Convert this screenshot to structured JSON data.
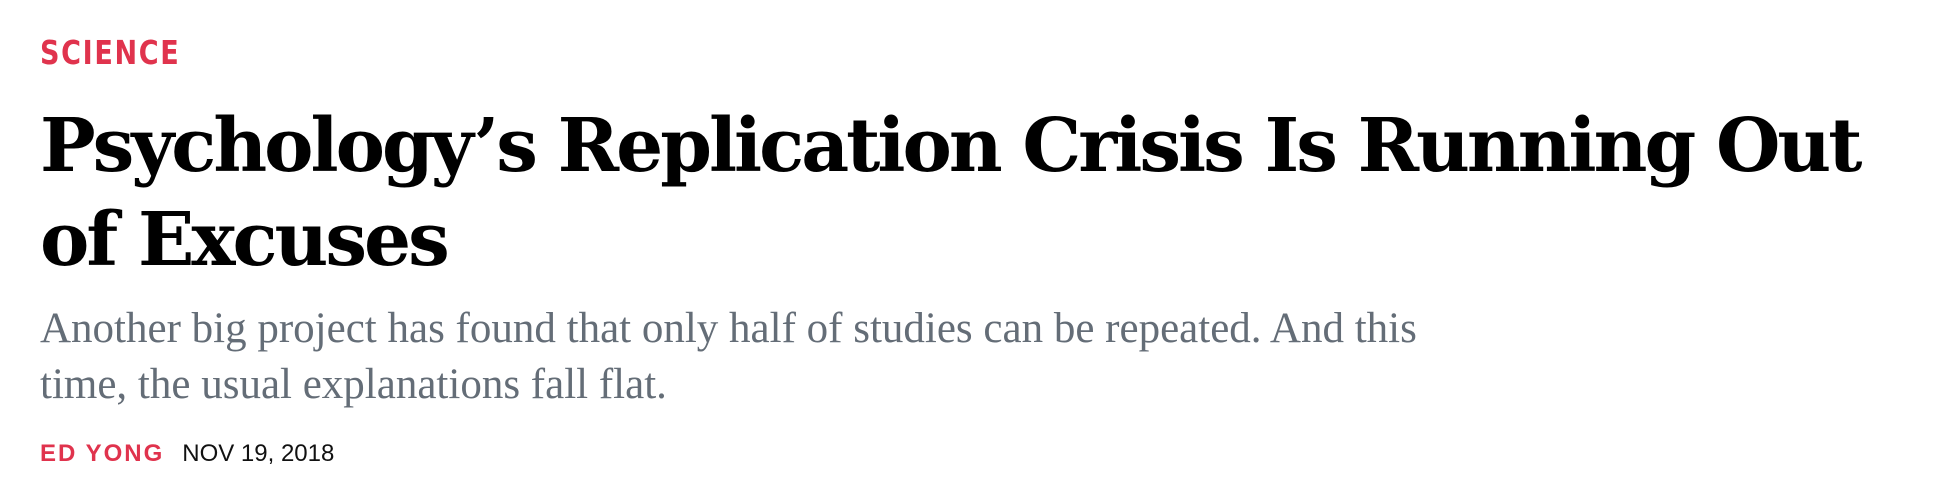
{
  "article": {
    "section": "SCIENCE",
    "headline": "Psychology’s Replication Crisis Is Running Out of Excuses",
    "dek": "Another big project has found that only half of studies can be repeated. And this time, the usual explanations fall flat.",
    "author": "ED YONG",
    "date": "NOV 19, 2018"
  },
  "colors": {
    "accent": "#e0334d",
    "headline": "#000000",
    "dek": "#646d77",
    "date": "#111111"
  }
}
